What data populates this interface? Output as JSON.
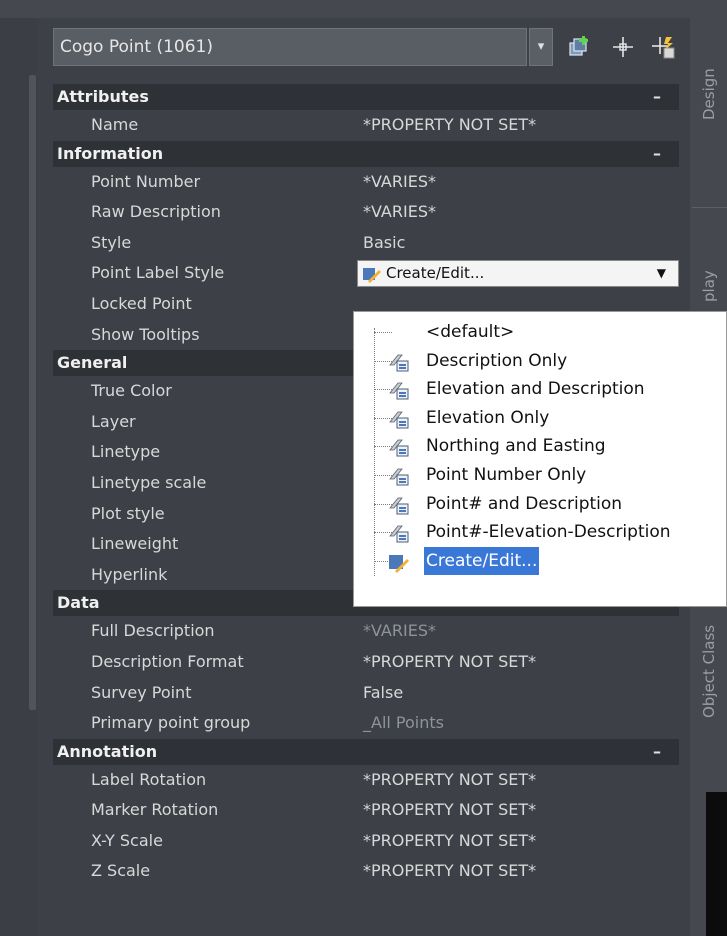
{
  "selector": {
    "label": "Cogo Point (1061)",
    "arrow": "▾"
  },
  "toolbar": {
    "icons": [
      "add-icon",
      "pick-point-icon",
      "quick-select-icon"
    ]
  },
  "sections": [
    {
      "title": "Attributes",
      "collapse": "–",
      "rows": [
        {
          "label": "Name",
          "value": "*PROPERTY NOT SET*"
        }
      ]
    },
    {
      "title": "Information",
      "collapse": "–",
      "rows": [
        {
          "label": "Point Number",
          "value": "*VARIES*"
        },
        {
          "label": "Raw Description",
          "value": "*VARIES*"
        },
        {
          "label": "Style",
          "value": "Basic"
        },
        {
          "label": "Point Label Style",
          "value": "Create/Edit...",
          "combo": true,
          "arrow": "▼"
        },
        {
          "label": "Locked Point",
          "value": ""
        },
        {
          "label": "Show Tooltips",
          "value": ""
        }
      ]
    },
    {
      "title": "General",
      "collapse": "",
      "rows": [
        {
          "label": "True Color",
          "value": ""
        },
        {
          "label": "Layer",
          "value": ""
        },
        {
          "label": "Linetype",
          "value": ""
        },
        {
          "label": "Linetype scale",
          "value": ""
        },
        {
          "label": "Plot style",
          "value": ""
        },
        {
          "label": "Lineweight",
          "value": ""
        },
        {
          "label": "Hyperlink",
          "value": ""
        }
      ]
    },
    {
      "title": "Data",
      "collapse": "–",
      "rows": [
        {
          "label": "Full Description",
          "value": "*VARIES*",
          "dim": true
        },
        {
          "label": "Description Format",
          "value": "*PROPERTY NOT SET*"
        },
        {
          "label": "Survey Point",
          "value": "False"
        },
        {
          "label": "Primary point group",
          "value": "_All Points",
          "dim": true
        }
      ]
    },
    {
      "title": "Annotation",
      "collapse": "–",
      "rows": [
        {
          "label": "Label Rotation",
          "value": "*PROPERTY NOT SET*"
        },
        {
          "label": "Marker Rotation",
          "value": "*PROPERTY NOT SET*"
        },
        {
          "label": "X-Y Scale",
          "value": "*PROPERTY NOT SET*"
        },
        {
          "label": "Z Scale",
          "value": "*PROPERTY NOT SET*"
        }
      ]
    }
  ],
  "dropdown": {
    "items": [
      {
        "label": "<default>",
        "icon": "none"
      },
      {
        "label": "Description Only",
        "icon": "label-style-icon"
      },
      {
        "label": "Elevation and Description",
        "icon": "label-style-icon"
      },
      {
        "label": "Elevation Only",
        "icon": "label-style-icon"
      },
      {
        "label": "Northing and Easting",
        "icon": "label-style-icon"
      },
      {
        "label": "Point Number Only",
        "icon": "label-style-icon"
      },
      {
        "label": "Point# and Description",
        "icon": "label-style-icon"
      },
      {
        "label": "Point#-Elevation-Description",
        "icon": "label-style-icon"
      },
      {
        "label": "Create/Edit...",
        "icon": "edit-style-icon",
        "selected": true
      }
    ]
  },
  "side_tabs": [
    {
      "label": "Design"
    },
    {
      "label": "play"
    },
    {
      "label": "Object Class"
    }
  ],
  "colors": {
    "panel": "#3d4046",
    "section": "#2e3136",
    "selection": "#3a78d8"
  }
}
